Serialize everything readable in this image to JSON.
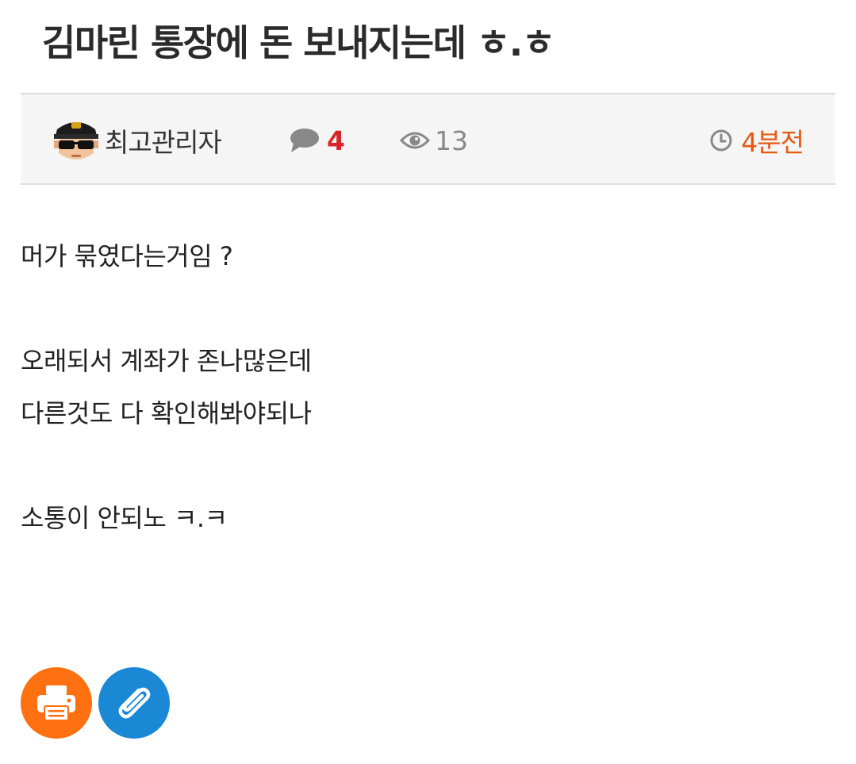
{
  "post": {
    "title": "김마린 통장에 돈 보내지는데 ㅎ.ㅎ"
  },
  "meta": {
    "author_name": "최고관리자",
    "comment_count": "4",
    "view_count": "13",
    "time_ago": "4분전",
    "colors": {
      "comment_accent": "#d7262b",
      "time_accent": "#e65a10",
      "icon_gray": "#888888"
    }
  },
  "content": {
    "lines": [
      "머가 묶였다는거임 ?",
      "",
      "오래되서 계좌가 존나많은데",
      "다른것도 다 확인해봐야되나",
      "",
      "소통이 안되노 ㅋ.ㅋ"
    ]
  },
  "actions": {
    "print": {
      "icon": "printer-icon",
      "color": "#ff7010"
    },
    "link": {
      "icon": "paperclip-icon",
      "color": "#1b88d6"
    }
  }
}
